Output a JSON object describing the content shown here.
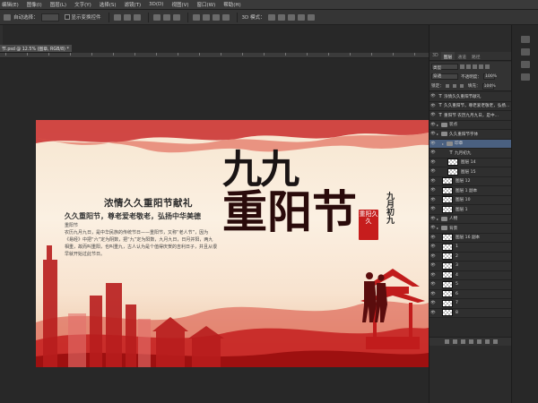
{
  "menu": {
    "items": [
      "编辑(E)",
      "图像(I)",
      "图层(L)",
      "文字(Y)",
      "选择(S)",
      "滤镜(T)",
      "3D(D)",
      "视图(V)",
      "窗口(W)",
      "帮助(H)"
    ]
  },
  "options": {
    "auto_select_label": "自动选择：",
    "transform_label": "显示变换控件",
    "mode_3d_label": "3D 模式："
  },
  "document": {
    "tab_title": "节.psd @ 12.5% (图章, RGB/8) *"
  },
  "artwork": {
    "subtitle": "浓情久久重阳节献礼",
    "slogan": "久久重阳节，尊老爱老敬老，弘扬中华美德",
    "body_label": "重阳节",
    "body": "农历九月九日，是中华民族的传统节日——重阳节，又称“老人节”，因为《易经》中把“六”定为阴数，把“九”定为阳数，九月九日，日月并阳，两九相重，故而叫重阳，也叫重九，古人认为是个值得庆贺的吉利日子，并且从很早就开始过此节日。",
    "title_line1": "九九",
    "title_line2": "重阳节",
    "seal_text": "重阳久久",
    "date_vertical": "九月初九"
  },
  "layers_panel": {
    "tabs": [
      "3D",
      "图层",
      "通道",
      "路径"
    ],
    "filter_label": "类型",
    "blend_mode": "穿透",
    "opacity_label": "不透明度：",
    "opacity_value": "100%",
    "lock_label": "锁定：",
    "fill_label": "填充：",
    "fill_value": "100%",
    "layers": [
      {
        "kind": "text",
        "indent": 0,
        "name": "浓情久久重阳节献礼",
        "selected": false
      },
      {
        "kind": "text",
        "indent": 0,
        "name": "久久重阳节，尊老爱老敬老，弘扬...",
        "selected": false
      },
      {
        "kind": "text",
        "indent": 0,
        "name": "重阳节 农历九月九日，是中...",
        "selected": false
      },
      {
        "kind": "group",
        "indent": 0,
        "name": "装点",
        "selected": false
      },
      {
        "kind": "group",
        "indent": 0,
        "name": "久久重阳节字体",
        "selected": false
      },
      {
        "kind": "group",
        "indent": 1,
        "name": "印章",
        "selected": true
      },
      {
        "kind": "text",
        "indent": 2,
        "name": "九月初九",
        "selected": false
      },
      {
        "kind": "image",
        "indent": 2,
        "name": "图层 14",
        "selected": false
      },
      {
        "kind": "image",
        "indent": 2,
        "name": "图层 15",
        "selected": false
      },
      {
        "kind": "image",
        "indent": 1,
        "name": "图层 12",
        "selected": false
      },
      {
        "kind": "image",
        "indent": 1,
        "name": "图层 1 副本",
        "selected": false
      },
      {
        "kind": "image",
        "indent": 1,
        "name": "图层 10",
        "selected": false
      },
      {
        "kind": "image",
        "indent": 1,
        "name": "图层 1",
        "selected": false
      },
      {
        "kind": "group",
        "indent": 0,
        "name": "人物",
        "selected": false
      },
      {
        "kind": "group",
        "indent": 0,
        "name": "背景",
        "selected": false
      },
      {
        "kind": "image",
        "indent": 1,
        "name": "图层 16 副本",
        "selected": false
      },
      {
        "kind": "image",
        "indent": 1,
        "name": "1",
        "selected": false
      },
      {
        "kind": "image",
        "indent": 1,
        "name": "2",
        "selected": false
      },
      {
        "kind": "image",
        "indent": 1,
        "name": "3",
        "selected": false
      },
      {
        "kind": "image",
        "indent": 1,
        "name": "4",
        "selected": false
      },
      {
        "kind": "image",
        "indent": 1,
        "name": "5",
        "selected": false
      },
      {
        "kind": "image",
        "indent": 1,
        "name": "6",
        "selected": false
      },
      {
        "kind": "image",
        "indent": 1,
        "name": "7",
        "selected": false
      },
      {
        "kind": "image",
        "indent": 1,
        "name": "8",
        "selected": false
      }
    ]
  },
  "colors": {
    "accent_red": "#c61d1d",
    "selected_layer": "#4a6080",
    "panel_bg": "#2b2b2b"
  }
}
